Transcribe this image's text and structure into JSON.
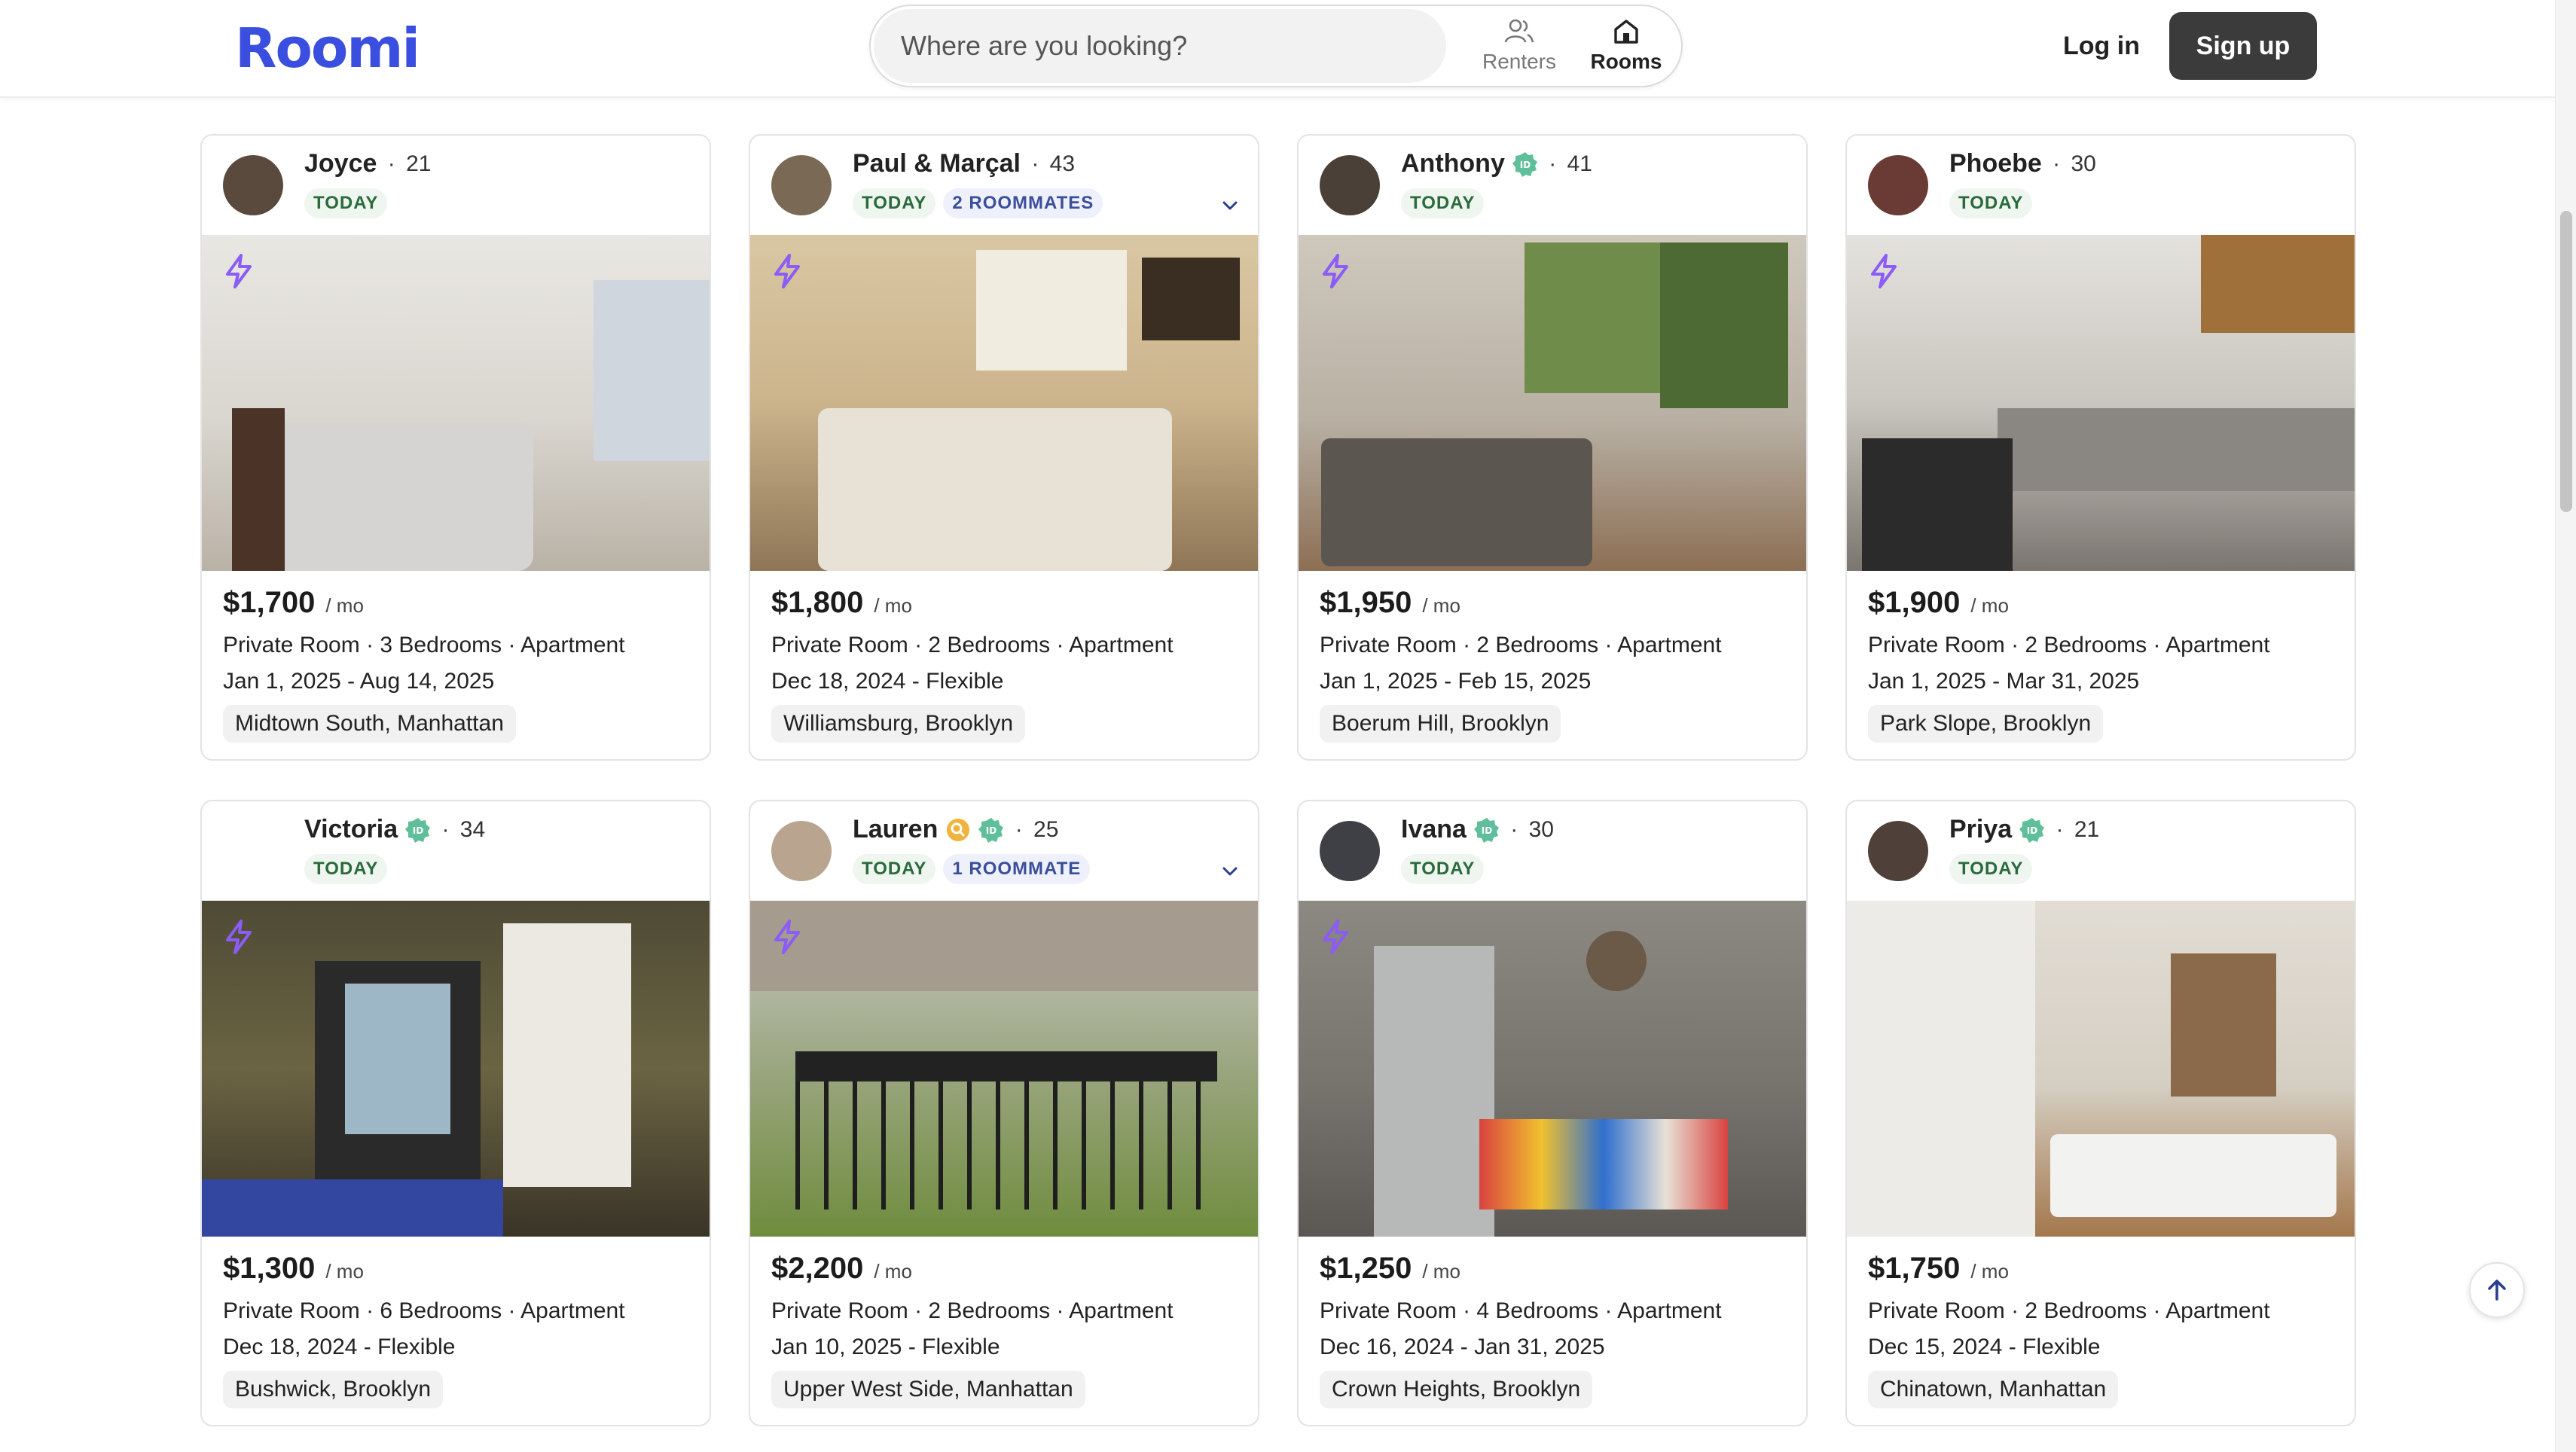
{
  "brand": {
    "logo": "Roomi",
    "accent": "#3a4fe0"
  },
  "search": {
    "placeholder": "Where are you looking?",
    "tabs": [
      {
        "label": "Renters",
        "icon": "users-icon",
        "active": false
      },
      {
        "label": "Rooms",
        "icon": "home-icon",
        "active": true
      }
    ]
  },
  "auth": {
    "login": "Log in",
    "signup": "Sign up"
  },
  "listings": [
    {
      "name": "Joyce",
      "age": "21",
      "verified": false,
      "checked": false,
      "badge": "TODAY",
      "roommates": "",
      "price": "$1,700",
      "per": "/ mo",
      "details": "Private Room · 3 Bedrooms · Apartment",
      "dates": "Jan 1, 2025 - Aug 14, 2025",
      "location": "Midtown South, Manhattan",
      "instant": true
    },
    {
      "name": "Paul & Marçal",
      "age": "43",
      "verified": false,
      "checked": false,
      "badge": "TODAY",
      "roommates": "2 ROOMMATES",
      "price": "$1,800",
      "per": "/ mo",
      "details": "Private Room · 2 Bedrooms · Apartment",
      "dates": "Dec 18, 2024 - Flexible",
      "location": "Williamsburg, Brooklyn",
      "instant": true
    },
    {
      "name": "Anthony",
      "age": "41",
      "verified": true,
      "checked": false,
      "badge": "TODAY",
      "roommates": "",
      "price": "$1,950",
      "per": "/ mo",
      "details": "Private Room · 2 Bedrooms · Apartment",
      "dates": "Jan 1, 2025 - Feb 15, 2025",
      "location": "Boerum Hill, Brooklyn",
      "instant": true
    },
    {
      "name": "Phoebe",
      "age": "30",
      "verified": false,
      "checked": false,
      "badge": "TODAY",
      "roommates": "",
      "price": "$1,900",
      "per": "/ mo",
      "details": "Private Room · 2 Bedrooms · Apartment",
      "dates": "Jan 1, 2025 - Mar 31, 2025",
      "location": "Park Slope, Brooklyn",
      "instant": true
    },
    {
      "name": "Victoria",
      "age": "34",
      "verified": true,
      "checked": false,
      "badge": "TODAY",
      "roommates": "",
      "price": "$1,300",
      "per": "/ mo",
      "details": "Private Room · 6 Bedrooms · Apartment",
      "dates": "Dec 18, 2024 - Flexible",
      "location": "Bushwick, Brooklyn",
      "instant": true
    },
    {
      "name": "Lauren",
      "age": "25",
      "verified": true,
      "checked": true,
      "badge": "TODAY",
      "roommates": "1 ROOMMATE",
      "price": "$2,200",
      "per": "/ mo",
      "details": "Private Room · 2 Bedrooms · Apartment",
      "dates": "Jan 10, 2025 - Flexible",
      "location": "Upper West Side, Manhattan",
      "instant": true
    },
    {
      "name": "Ivana",
      "age": "30",
      "verified": true,
      "checked": false,
      "badge": "TODAY",
      "roommates": "",
      "price": "$1,250",
      "per": "/ mo",
      "details": "Private Room · 4 Bedrooms · Apartment",
      "dates": "Dec 16, 2024 - Jan 31, 2025",
      "location": "Crown Heights, Brooklyn",
      "instant": true
    },
    {
      "name": "Priya",
      "age": "21",
      "verified": true,
      "checked": false,
      "badge": "TODAY",
      "roommates": "",
      "price": "$1,750",
      "per": "/ mo",
      "details": "Private Room · 2 Bedrooms · Apartment",
      "dates": "Dec 15, 2024 - Flexible",
      "location": "Chinatown, Manhattan",
      "instant": false
    }
  ]
}
